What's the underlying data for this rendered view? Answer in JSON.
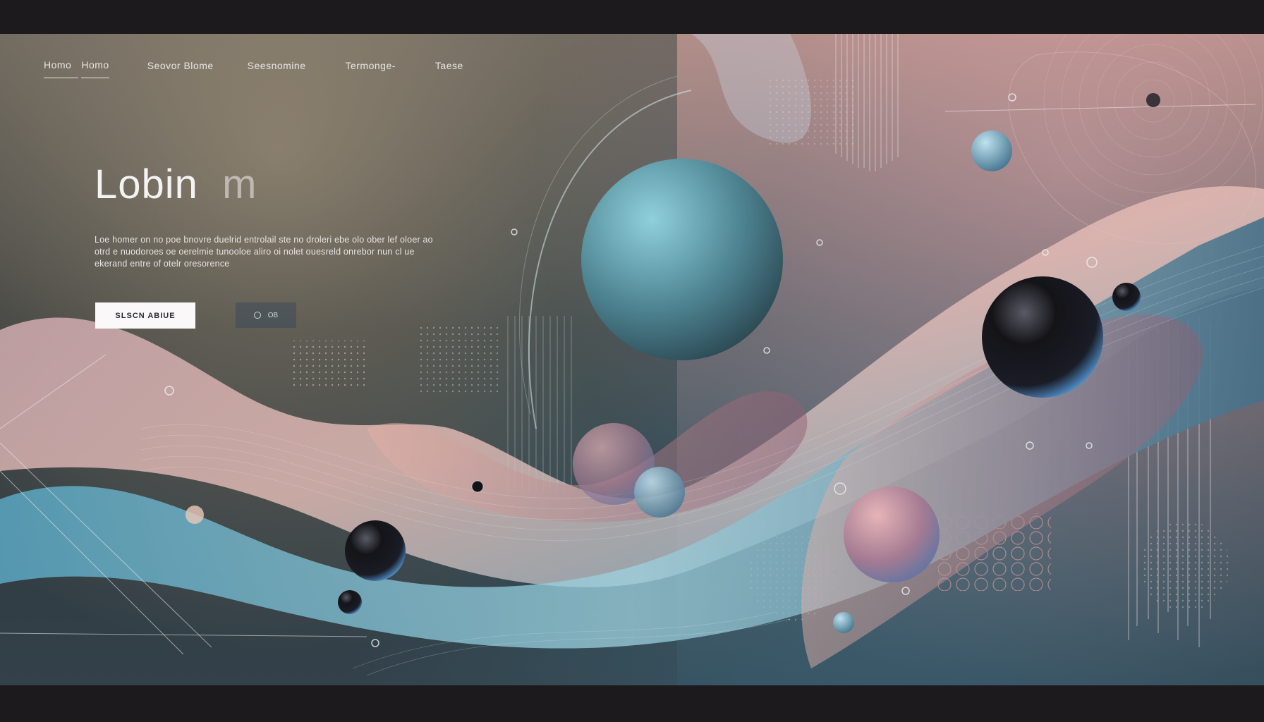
{
  "nav": {
    "items": [
      {
        "label": "Homo",
        "active": true
      },
      {
        "label": "Homo",
        "active": true
      },
      {
        "label": "Seovor Blome",
        "active": false
      },
      {
        "label": "Seesnomine",
        "active": false
      },
      {
        "label": "Termonge-",
        "active": false
      },
      {
        "label": "Taese",
        "active": false
      }
    ]
  },
  "hero": {
    "title_main": "Lobin",
    "title_faded": "  ",
    "title_tail": "m",
    "body": "Loe homer on no poe bnovre duelrid entrolail ste no droleri ebe olo ober lef oloer ao otrd e nuodoroes oe oerelmie tunooloe aliro oi nolet ouesreld onrebor nun cl ue ekerand entre of otelr oresorence",
    "primary_button": "SLSCN ABIUE",
    "secondary_button": "OB",
    "secondary_icon": "ring-icon"
  },
  "colors": {
    "accent_teal": "#6fa9b5",
    "accent_pink": "#d9a3a8",
    "sphere_dark": "#141418",
    "button_bg": "#faf8f8"
  }
}
